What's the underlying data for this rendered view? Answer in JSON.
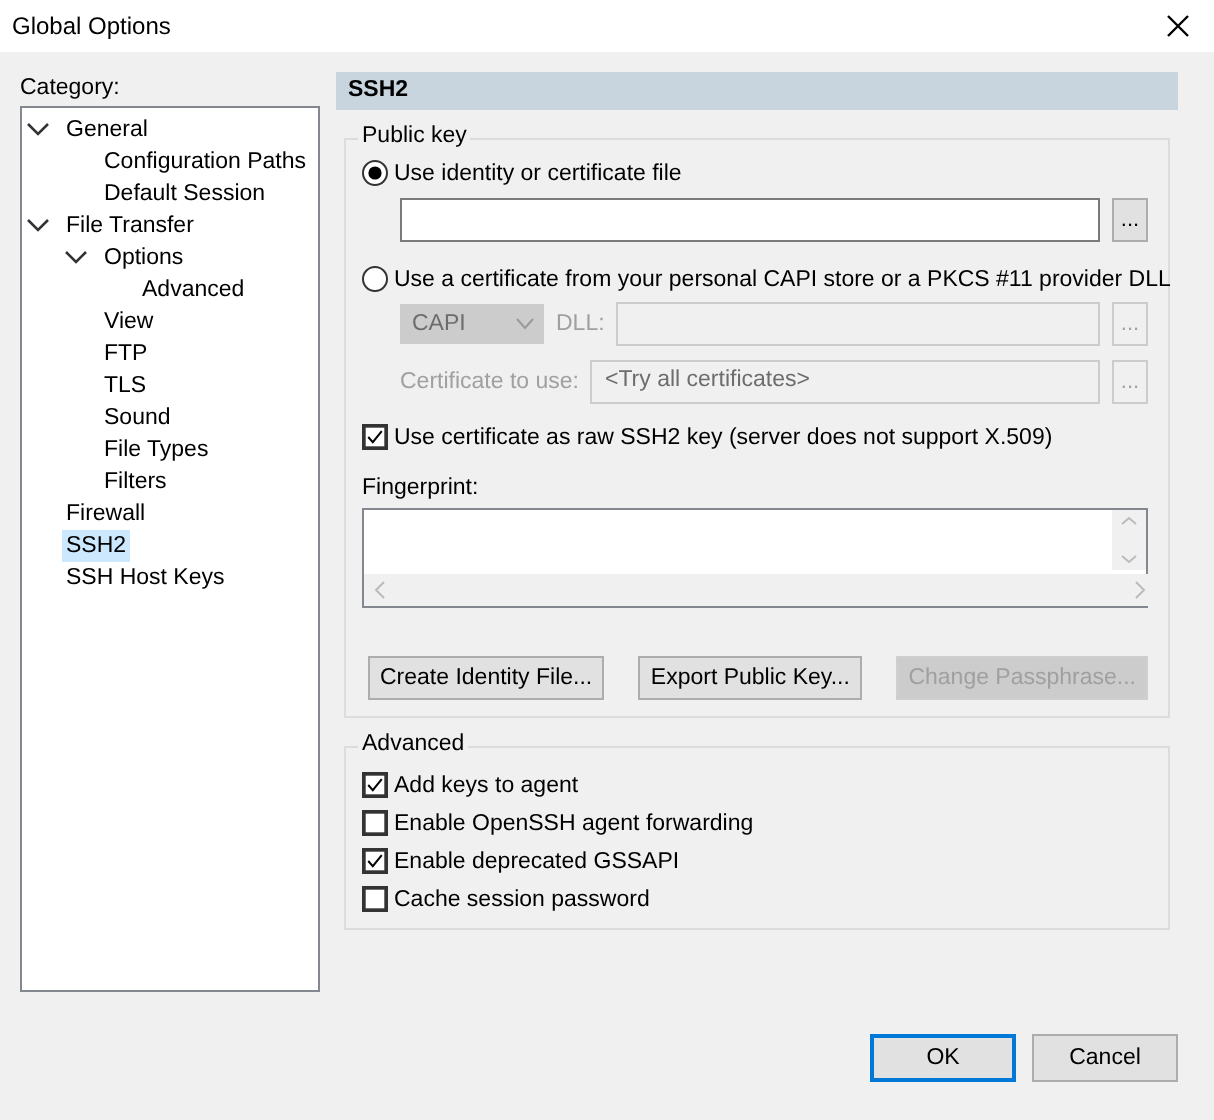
{
  "window": {
    "title": "Global Options"
  },
  "category_label": "Category:",
  "tree": [
    {
      "label": "General",
      "selected": false,
      "expanded": true,
      "children": [
        {
          "label": "Configuration Paths",
          "selected": false
        },
        {
          "label": "Default Session",
          "selected": false
        }
      ]
    },
    {
      "label": "File Transfer",
      "selected": false,
      "expanded": true,
      "children": [
        {
          "label": "Options",
          "selected": false,
          "expanded": true,
          "children": [
            {
              "label": "Advanced",
              "selected": false
            }
          ]
        },
        {
          "label": "View",
          "selected": false
        },
        {
          "label": "FTP",
          "selected": false
        },
        {
          "label": "TLS",
          "selected": false
        },
        {
          "label": "Sound",
          "selected": false
        },
        {
          "label": "File Types",
          "selected": false
        },
        {
          "label": "Filters",
          "selected": false
        }
      ]
    },
    {
      "label": "Firewall",
      "selected": false
    },
    {
      "label": "SSH2",
      "selected": true
    },
    {
      "label": "SSH Host Keys",
      "selected": false
    }
  ],
  "panel": {
    "title": "SSH2",
    "public_key": {
      "legend": "Public key",
      "identity_option": {
        "label": "Use identity or certificate file",
        "selected": true
      },
      "identity_browse": "...",
      "capi_option": {
        "label": "Use a certificate from your personal CAPI store or a PKCS #11 provider DLL",
        "selected": false
      },
      "provider": {
        "value": "CAPI",
        "disabled": true
      },
      "dll_label": "DLL:",
      "dll_browse": "...",
      "cert_label": "Certificate to use:",
      "cert_field": {
        "value": "<Try all certificates>",
        "disabled": true
      },
      "cert_browse": "...",
      "raw_key": {
        "label": "Use certificate as raw SSH2 key (server does not support X.509)",
        "checked": true
      },
      "fingerprint_label": "Fingerprint:",
      "buttons": [
        {
          "label": "Create Identity File...",
          "disabled": false
        },
        {
          "label": "Export Public Key...",
          "disabled": false
        },
        {
          "label": "Change Passphrase...",
          "disabled": true
        }
      ]
    },
    "advanced": {
      "legend": "Advanced",
      "options": [
        {
          "label": "Add keys to agent",
          "checked": true
        },
        {
          "label": "Enable OpenSSH agent forwarding",
          "checked": false
        },
        {
          "label": "Enable deprecated GSSAPI",
          "checked": true
        },
        {
          "label": "Cache session password",
          "checked": false
        }
      ]
    }
  },
  "buttons": [
    {
      "label": "OK",
      "default": true
    },
    {
      "label": "Cancel",
      "default": false
    }
  ]
}
